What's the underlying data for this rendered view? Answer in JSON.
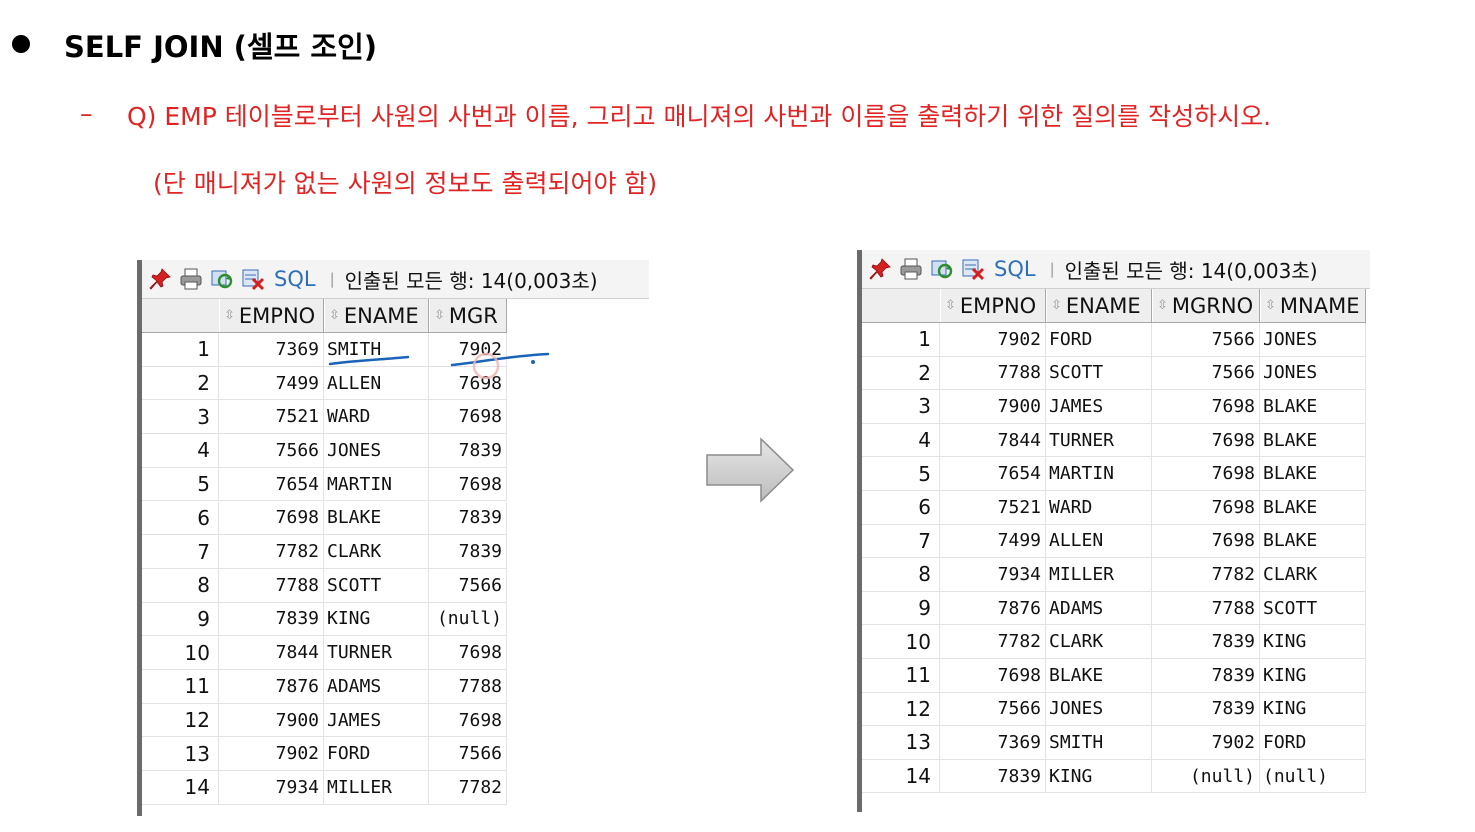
{
  "heading": {
    "text": "SELF JOIN (셀프 조인)"
  },
  "question": {
    "dash": "–",
    "line1": "Q) EMP 테이블로부터 사원의 사번과 이름, 그리고 매니져의 사번과 이름을 출력하기 위한 질의를 작성하시오.",
    "line2": "(단 매니져가 없는 사원의 정보도 출력되어야 함)"
  },
  "left_panel": {
    "sql_label": "SQL",
    "separator": "|",
    "fetch_status": "인출된 모든 행: 14(0,003초)",
    "columns": [
      "EMPNO",
      "ENAME",
      "MGR"
    ],
    "rows": [
      [
        "1",
        "7369",
        "SMITH",
        "7902"
      ],
      [
        "2",
        "7499",
        "ALLEN",
        "7698"
      ],
      [
        "3",
        "7521",
        "WARD",
        "7698"
      ],
      [
        "4",
        "7566",
        "JONES",
        "7839"
      ],
      [
        "5",
        "7654",
        "MARTIN",
        "7698"
      ],
      [
        "6",
        "7698",
        "BLAKE",
        "7839"
      ],
      [
        "7",
        "7782",
        "CLARK",
        "7839"
      ],
      [
        "8",
        "7788",
        "SCOTT",
        "7566"
      ],
      [
        "9",
        "7839",
        "KING",
        "(null)"
      ],
      [
        "10",
        "7844",
        "TURNER",
        "7698"
      ],
      [
        "11",
        "7876",
        "ADAMS",
        "7788"
      ],
      [
        "12",
        "7900",
        "JAMES",
        "7698"
      ],
      [
        "13",
        "7902",
        "FORD",
        "7566"
      ],
      [
        "14",
        "7934",
        "MILLER",
        "7782"
      ]
    ]
  },
  "right_panel": {
    "sql_label": "SQL",
    "separator": "|",
    "fetch_status": "인출된 모든 행: 14(0,003초)",
    "columns": [
      "EMPNO",
      "ENAME",
      "MGRNO",
      "MNAME"
    ],
    "rows": [
      [
        "1",
        "7902",
        "FORD",
        "7566",
        "JONES"
      ],
      [
        "2",
        "7788",
        "SCOTT",
        "7566",
        "JONES"
      ],
      [
        "3",
        "7900",
        "JAMES",
        "7698",
        "BLAKE"
      ],
      [
        "4",
        "7844",
        "TURNER",
        "7698",
        "BLAKE"
      ],
      [
        "5",
        "7654",
        "MARTIN",
        "7698",
        "BLAKE"
      ],
      [
        "6",
        "7521",
        "WARD",
        "7698",
        "BLAKE"
      ],
      [
        "7",
        "7499",
        "ALLEN",
        "7698",
        "BLAKE"
      ],
      [
        "8",
        "7934",
        "MILLER",
        "7782",
        "CLARK"
      ],
      [
        "9",
        "7876",
        "ADAMS",
        "7788",
        "SCOTT"
      ],
      [
        "10",
        "7782",
        "CLARK",
        "7839",
        "KING"
      ],
      [
        "11",
        "7698",
        "BLAKE",
        "7839",
        "KING"
      ],
      [
        "12",
        "7566",
        "JONES",
        "7839",
        "KING"
      ],
      [
        "13",
        "7369",
        "SMITH",
        "7902",
        "FORD"
      ],
      [
        "14",
        "7839",
        "KING",
        "(null)",
        "(null)"
      ]
    ]
  },
  "colors": {
    "question": "#e02424",
    "sql_link": "#2f6fb8",
    "annotation": "#1a63b8"
  },
  "icons": [
    "pin-icon",
    "print-icon",
    "refresh-icon",
    "clear-icon",
    "arrow-right-icon"
  ]
}
